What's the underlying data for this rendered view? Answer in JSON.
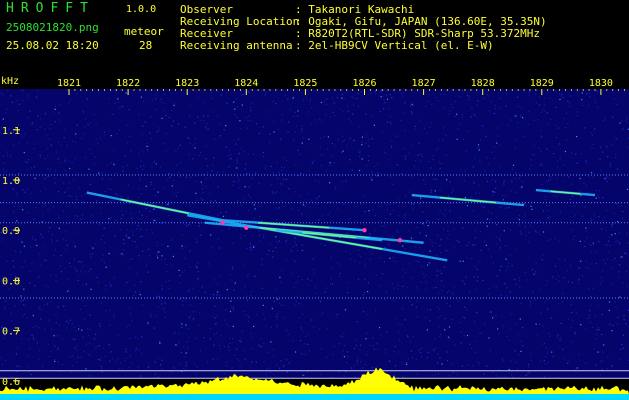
{
  "header": {
    "app_title": "HROFFT",
    "version": "1.0.0",
    "filename": "2508021820.png",
    "meteor_label": "meteor",
    "datetime": "25.08.02 18:20",
    "meteor_count": "28",
    "info": [
      {
        "label": "Observer",
        "value": ": Takanori Kawachi"
      },
      {
        "label": "Receiving Location",
        "value": ": Ogaki, Gifu, JAPAN (136.60E, 35.35N)"
      },
      {
        "label": "Receiver",
        "value": ": R820T2(RTL-SDR) SDR-Sharp 53.372MHz"
      },
      {
        "label": "Receiving antenna",
        "value": ": 2el-HB9CV Vertical (el. E-W)"
      }
    ]
  },
  "plot": {
    "y_unit": "kHz",
    "x_ticks": [
      "1821",
      "1822",
      "1823",
      "1824",
      "1825",
      "1826",
      "1827",
      "1828",
      "1829",
      "1830"
    ],
    "y_ticks": [
      "1.1",
      "1.0",
      "0.9",
      "0.8",
      "0.7",
      "0.6"
    ],
    "colors": {
      "background": "#04046a",
      "grid": "#3a3ad0",
      "text": "#ffff33",
      "spectrum": "#ffff00",
      "spectrum_base": "#00d8ff"
    }
  },
  "chart_data": {
    "type": "heatmap",
    "title": "",
    "xlabel": "",
    "ylabel": "kHz",
    "x_ticks": [
      1821,
      1822,
      1823,
      1824,
      1825,
      1826,
      1827,
      1828,
      1829,
      1830
    ],
    "y_ticks": [
      1.1,
      1.0,
      0.9,
      0.8,
      0.7,
      0.6
    ],
    "xlim": [
      1820.6,
      1830.4
    ],
    "ylim": [
      0.58,
      1.16
    ],
    "horizontal_lines_khz": [
      1.01,
      0.955,
      0.915,
      0.765
    ],
    "meteor_traces": [
      {
        "from": [
          1821.3,
          0.975
        ],
        "to": [
          1823.6,
          0.92
        ]
      },
      {
        "from": [
          1823.0,
          0.93
        ],
        "to": [
          1827.4,
          0.84
        ]
      },
      {
        "from": [
          1823.3,
          0.915
        ],
        "to": [
          1827.0,
          0.875
        ]
      },
      {
        "from": [
          1823.6,
          0.92
        ],
        "to": [
          1826.0,
          0.9
        ]
      },
      {
        "from": [
          1824.5,
          0.9
        ],
        "to": [
          1826.3,
          0.88
        ]
      },
      {
        "from": [
          1826.8,
          0.97
        ],
        "to": [
          1828.7,
          0.95
        ]
      },
      {
        "from": [
          1828.9,
          0.98
        ],
        "to": [
          1829.9,
          0.97
        ]
      }
    ]
  }
}
